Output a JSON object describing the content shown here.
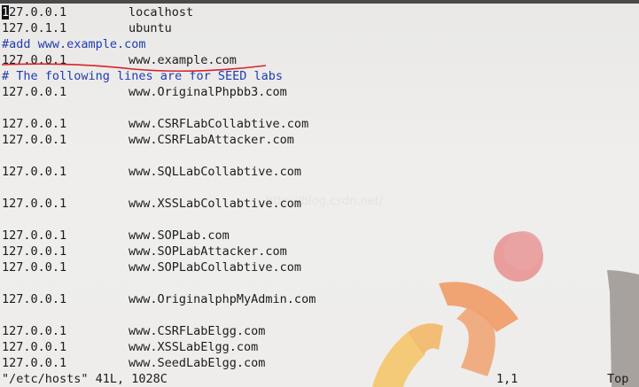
{
  "editor": {
    "lines": [
      {
        "type": "entry",
        "ip": "127.0.0.1",
        "host": "localhost",
        "cursor_char": "1",
        "ip_rest": "27.0.0.1"
      },
      {
        "type": "entry",
        "ip": "127.0.1.1",
        "host": "ubuntu"
      },
      {
        "type": "comment",
        "text": "#add www.example.com"
      },
      {
        "type": "entry",
        "ip": "127.0.0.1",
        "host": "www.example.com"
      },
      {
        "type": "comment",
        "text": "# The following lines are for SEED labs"
      },
      {
        "type": "entry",
        "ip": "127.0.0.1",
        "host": "www.OriginalPhpbb3.com"
      },
      {
        "type": "blank"
      },
      {
        "type": "entry",
        "ip": "127.0.0.1",
        "host": "www.CSRFLabCollabtive.com"
      },
      {
        "type": "entry",
        "ip": "127.0.0.1",
        "host": "www.CSRFLabAttacker.com"
      },
      {
        "type": "blank"
      },
      {
        "type": "entry",
        "ip": "127.0.0.1",
        "host": "www.SQLLabCollabtive.com"
      },
      {
        "type": "blank"
      },
      {
        "type": "entry",
        "ip": "127.0.0.1",
        "host": "www.XSSLabCollabtive.com"
      },
      {
        "type": "blank"
      },
      {
        "type": "entry",
        "ip": "127.0.0.1",
        "host": "www.SOPLab.com"
      },
      {
        "type": "entry",
        "ip": "127.0.0.1",
        "host": "www.SOPLabAttacker.com"
      },
      {
        "type": "entry",
        "ip": "127.0.0.1",
        "host": "www.SOPLabCollabtive.com"
      },
      {
        "type": "blank"
      },
      {
        "type": "entry",
        "ip": "127.0.0.1",
        "host": "www.OriginalphpMyAdmin.com"
      },
      {
        "type": "blank"
      },
      {
        "type": "entry",
        "ip": "127.0.0.1",
        "host": "www.CSRFLabElgg.com"
      },
      {
        "type": "entry",
        "ip": "127.0.0.1",
        "host": "www.XSSLabElgg.com"
      },
      {
        "type": "entry",
        "ip": "127.0.0.1",
        "host": "www.SeedLabElgg.com"
      }
    ]
  },
  "statusbar": {
    "file": "\"/etc/hosts\" 41L, 1028C",
    "position": "1,1",
    "scroll": "Top"
  },
  "watermark": "http://blog.csdn.net/",
  "colors": {
    "comment": "#1f3cb3",
    "annotation": "#d8232a",
    "background": "#eeedeb"
  },
  "icons": {
    "background_logo": "ubuntu-logo-icon"
  }
}
